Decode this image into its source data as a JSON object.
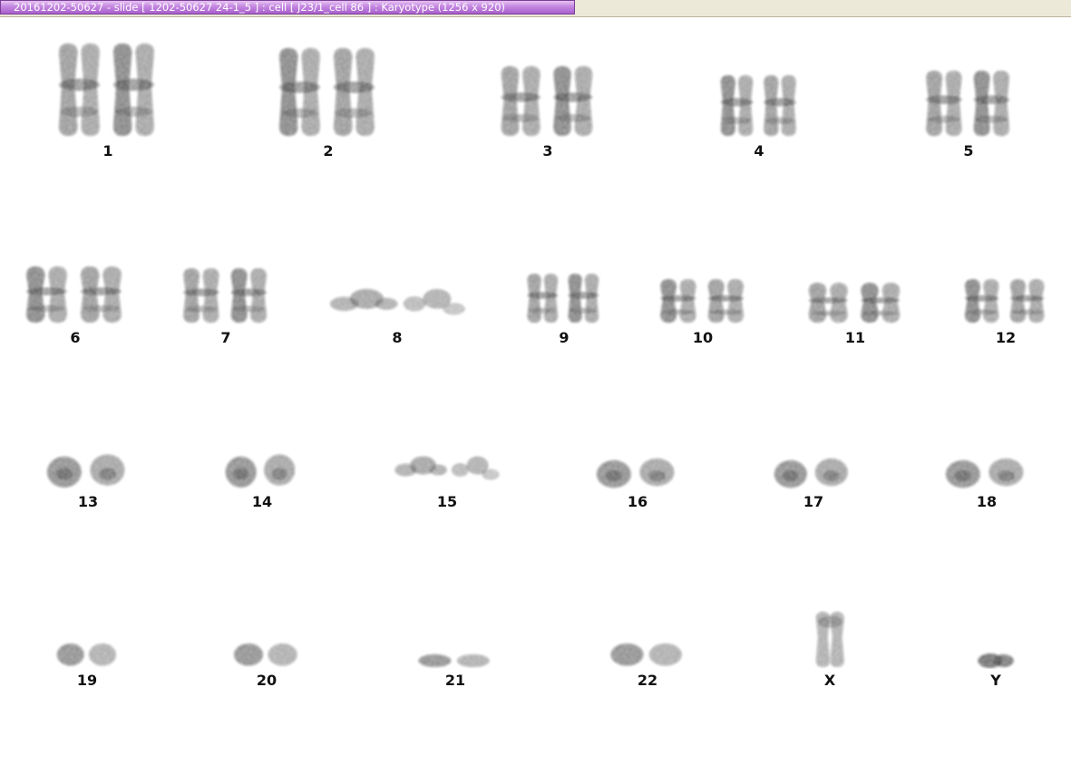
{
  "window": {
    "title": "20161202-50627 - slide [ 1202-50627 24-1_5 ] : cell [ J23/1_cell 86 ] : Karyotype  (1256 x 920)"
  },
  "colors": {
    "title_tab": "#b878d8",
    "chromosome_ink": "#1a1a1a",
    "background": "#ffffff"
  },
  "karyotype": {
    "chromosomes": [
      {
        "label": "1",
        "shape": "X"
      },
      {
        "label": "2",
        "shape": "X"
      },
      {
        "label": "3",
        "shape": "X"
      },
      {
        "label": "4",
        "shape": "X"
      },
      {
        "label": "5",
        "shape": "X"
      },
      {
        "label": "6",
        "shape": "X"
      },
      {
        "label": "7",
        "shape": "X"
      },
      {
        "label": "8",
        "shape": "bent"
      },
      {
        "label": "9",
        "shape": "X"
      },
      {
        "label": "10",
        "shape": "X"
      },
      {
        "label": "11",
        "shape": "X"
      },
      {
        "label": "12",
        "shape": "X"
      },
      {
        "label": "13",
        "shape": "blob"
      },
      {
        "label": "14",
        "shape": "blob"
      },
      {
        "label": "15",
        "shape": "bent"
      },
      {
        "label": "16",
        "shape": "blob"
      },
      {
        "label": "17",
        "shape": "blob"
      },
      {
        "label": "18",
        "shape": "blob"
      },
      {
        "label": "19",
        "shape": "small"
      },
      {
        "label": "20",
        "shape": "small"
      },
      {
        "label": "21",
        "shape": "small"
      },
      {
        "label": "22",
        "shape": "small"
      },
      {
        "label": "X",
        "shape": "single"
      },
      {
        "label": "Y",
        "shape": "single-small"
      }
    ]
  }
}
